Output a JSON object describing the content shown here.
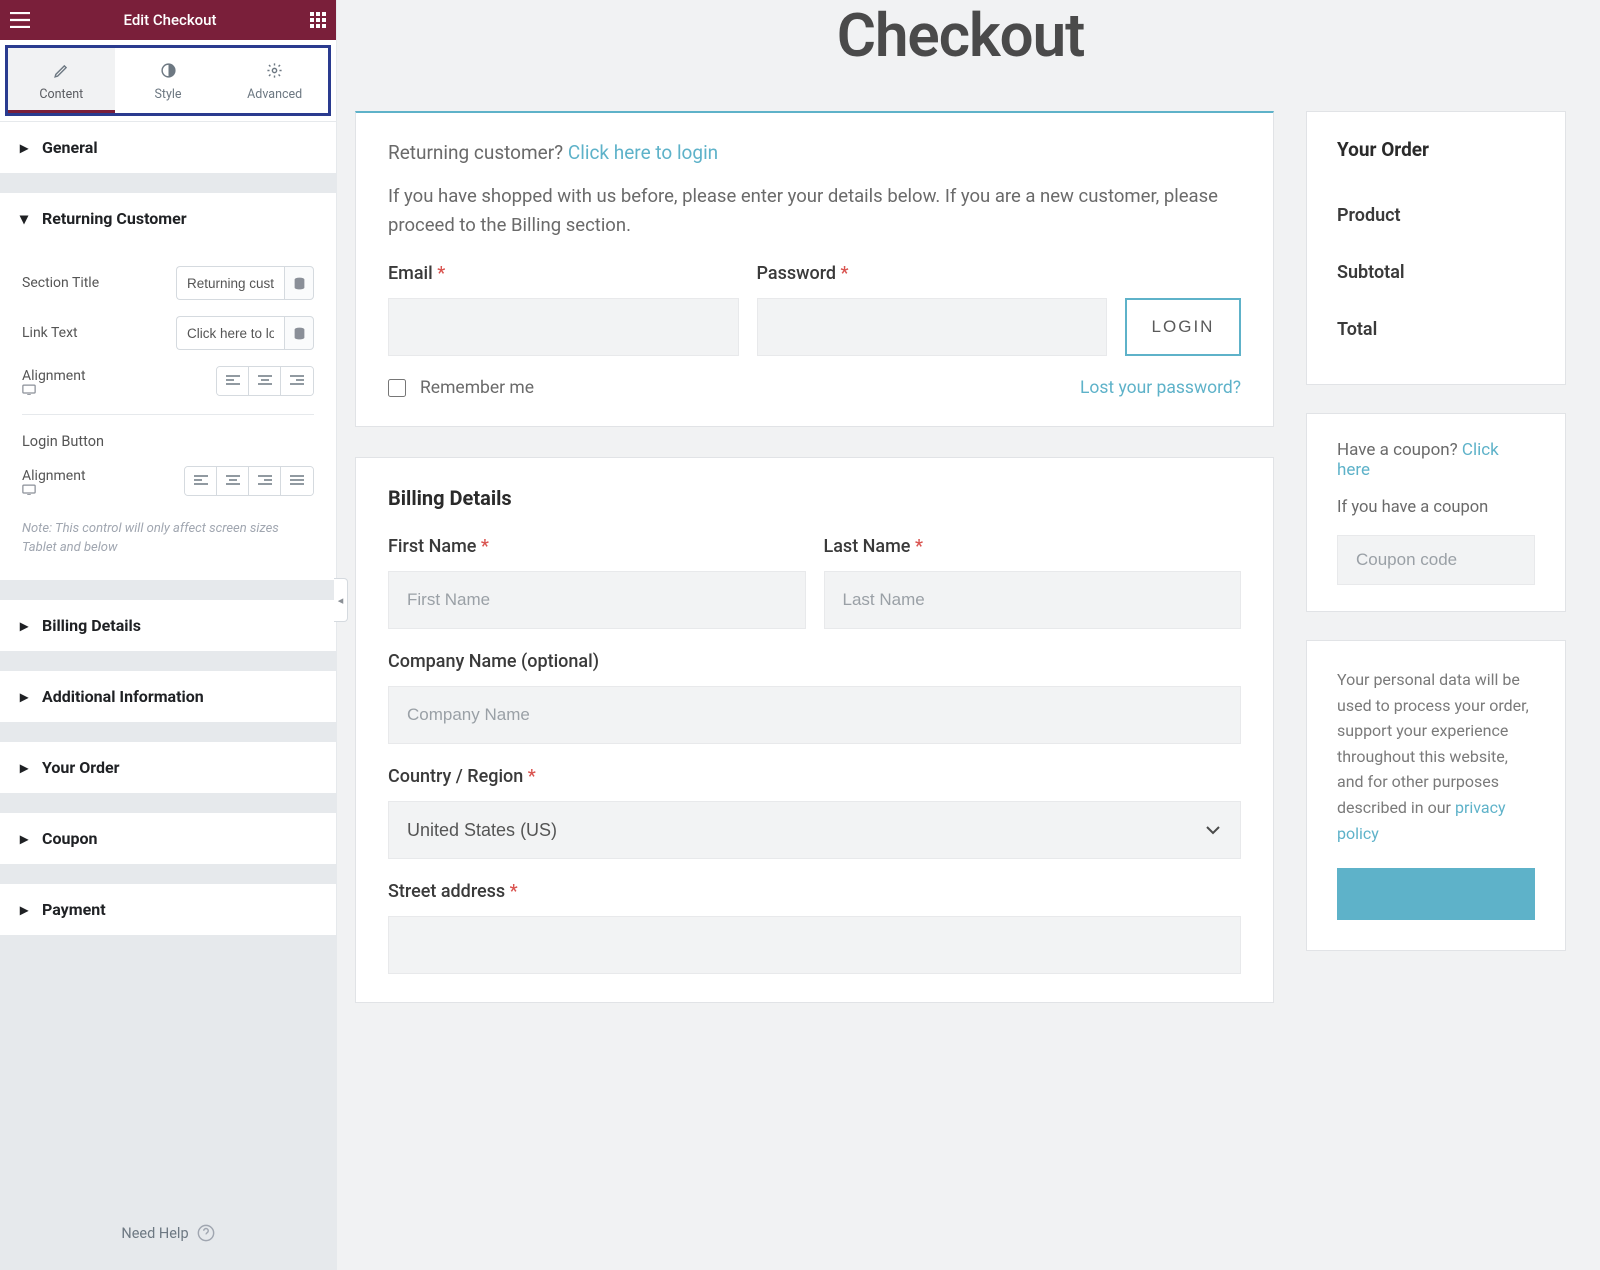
{
  "sidebar": {
    "title": "Edit Checkout",
    "tabs": {
      "content": "Content",
      "style": "Style",
      "advanced": "Advanced"
    },
    "sections": {
      "general": "General",
      "returning_customer": "Returning Customer",
      "billing_details": "Billing Details",
      "additional_information": "Additional Information",
      "your_order": "Your Order",
      "coupon": "Coupon",
      "payment": "Payment"
    },
    "returning": {
      "section_title_label": "Section Title",
      "section_title_value": "Returning customer?",
      "link_text_label": "Link Text",
      "link_text_value": "Click here to login",
      "alignment_label": "Alignment",
      "login_button_heading": "Login Button",
      "note": "Note: This control will only affect screen sizes Tablet and below"
    },
    "footer": "Need Help"
  },
  "preview": {
    "title": "Checkout",
    "returning": {
      "prompt": "Returning customer? ",
      "link": "Click here to login",
      "desc": "If you have shopped with us before, please enter your details below. If you are a new customer, please proceed to the Billing section.",
      "email_label": "Email ",
      "password_label": "Password ",
      "login_btn": "LOGIN",
      "remember": "Remember me",
      "lost": "Lost your password?"
    },
    "billing": {
      "heading": "Billing Details",
      "first_name": "First Name ",
      "first_name_ph": "First Name",
      "last_name": "Last Name ",
      "last_name_ph": "Last Name",
      "company": "Company Name (optional)",
      "company_ph": "Company Name",
      "country": "Country / Region ",
      "country_value": "United States (US)",
      "street": "Street address "
    },
    "order": {
      "heading": "Your Order",
      "product": "Product",
      "subtotal": "Subtotal",
      "total": "Total"
    },
    "coupon": {
      "prompt": "Have a coupon? ",
      "link": "Click here",
      "desc": "If you have a coupon",
      "placeholder": "Coupon code"
    },
    "payment": {
      "privacy_start": "Your personal data will be used to process your order, support your experience throughout this website, and for other purposes described in our ",
      "privacy_link": "privacy policy"
    }
  },
  "star": "*"
}
